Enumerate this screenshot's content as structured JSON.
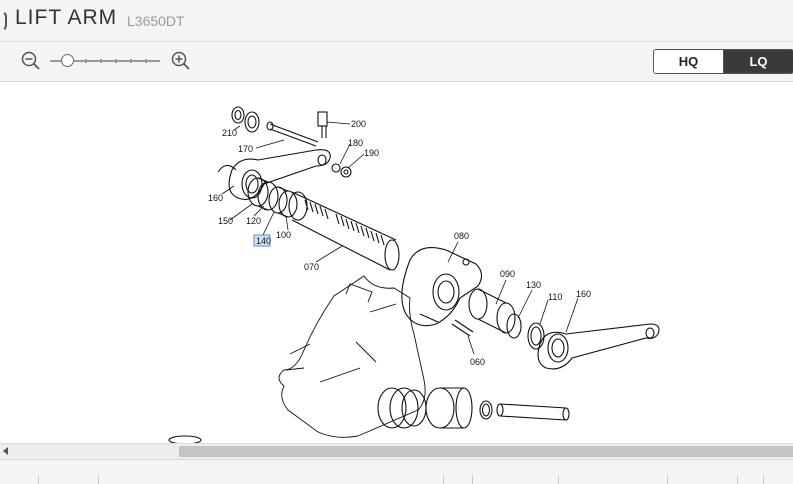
{
  "header": {
    "title": "LIFT ARM",
    "model": "L3650DT"
  },
  "toolbar": {
    "zoom_out_icon": "zoom-out-icon",
    "zoom_in_icon": "zoom-in-icon",
    "zoom_level": 0.12,
    "quality": {
      "hq_label": "HQ",
      "lq_label": "LQ",
      "selected": "LQ"
    }
  },
  "diagram": {
    "labels": {
      "p210": "210",
      "p200": "200",
      "p170": "170",
      "p180": "180",
      "p190": "190",
      "p160a": "160",
      "p150": "150",
      "p120": "120",
      "p140": "140",
      "p100": "100",
      "p070": "070",
      "p080": "080",
      "p090": "090",
      "p130": "130",
      "p110": "110",
      "p160b": "160",
      "p060": "060"
    },
    "highlighted": "140"
  },
  "colors": {
    "highlight": "#cfe3f7",
    "highlight_border": "#5b8fd1",
    "lq_bg": "#3a3a3a"
  }
}
